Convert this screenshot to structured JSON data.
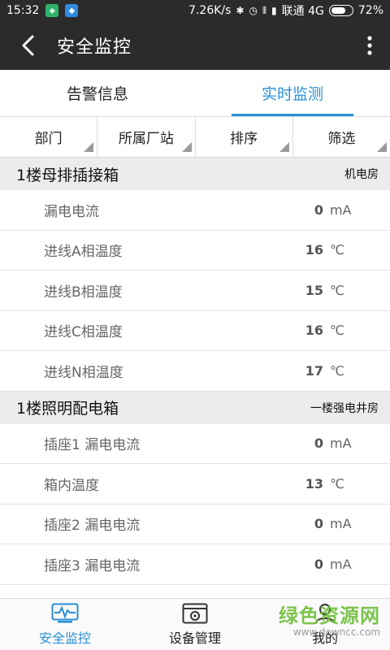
{
  "status_bar": {
    "time": "15:32",
    "speed": "7.26K/s",
    "carrier": "联通 4G",
    "battery": "72%",
    "battery_level": 0.72,
    "icons": [
      "shield-badge-icon",
      "app-badge-icon",
      "bluetooth-icon",
      "alarm-icon",
      "vibrate-icon",
      "signal-icon",
      "battery-icon"
    ]
  },
  "toolbar": {
    "title": "安全监控",
    "back_icon": "back-arrow-icon",
    "more_icon": "more-vertical-icon"
  },
  "tabs": [
    {
      "label": "告警信息",
      "active": false
    },
    {
      "label": "实时监测",
      "active": true
    }
  ],
  "filters": [
    {
      "label": "部门"
    },
    {
      "label": "所属厂站"
    },
    {
      "label": "排序"
    },
    {
      "label": "筛选"
    }
  ],
  "groups": [
    {
      "name": "1楼母排插接箱",
      "location": "机电房",
      "rows": [
        {
          "label": "漏电电流",
          "value": "0",
          "unit": "mA"
        },
        {
          "label": "进线A相温度",
          "value": "16",
          "unit": "℃"
        },
        {
          "label": "进线B相温度",
          "value": "15",
          "unit": "℃"
        },
        {
          "label": "进线C相温度",
          "value": "16",
          "unit": "℃"
        },
        {
          "label": "进线N相温度",
          "value": "17",
          "unit": "℃"
        }
      ]
    },
    {
      "name": "1楼照明配电箱",
      "location": "一楼强电井房",
      "rows": [
        {
          "label": "插座1 漏电电流",
          "value": "0",
          "unit": "mA"
        },
        {
          "label": "箱内温度",
          "value": "13",
          "unit": "℃"
        },
        {
          "label": "插座2 漏电电流",
          "value": "0",
          "unit": "mA"
        },
        {
          "label": "插座3 漏电电流",
          "value": "0",
          "unit": "mA"
        }
      ]
    }
  ],
  "bottom_nav": [
    {
      "label": "安全监控",
      "icon": "monitor-pulse-icon",
      "active": true
    },
    {
      "label": "设备管理",
      "icon": "device-gear-icon",
      "active": false
    },
    {
      "label": "我的",
      "icon": "user-icon",
      "active": false
    }
  ],
  "watermark": {
    "main": "绿色资源网",
    "sub": "www.downcc.com"
  },
  "colors": {
    "accent": "#2a8fd8",
    "toolbar_bg": "#2b2b2b",
    "group_header_bg": "#ececec"
  }
}
